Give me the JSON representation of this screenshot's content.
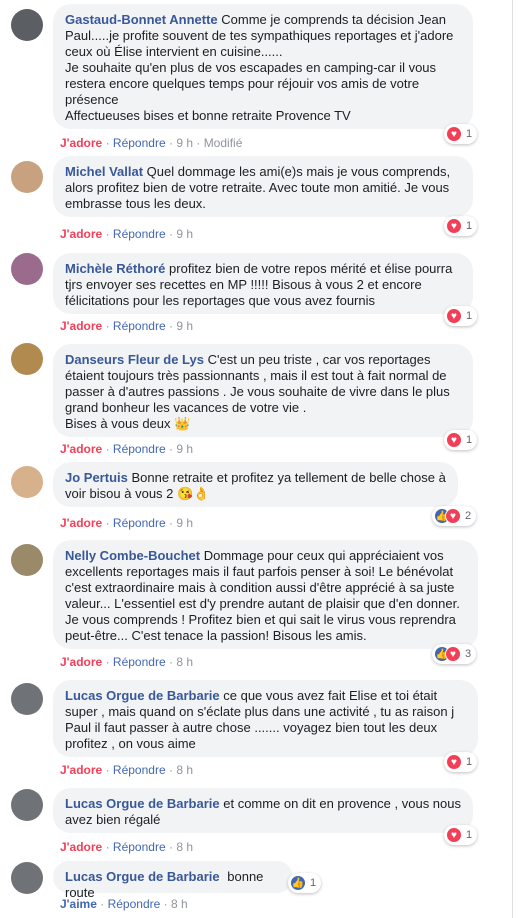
{
  "comments": [
    {
      "author": "Gastaud-Bonnet Annette",
      "text": "Comme je comprends ta décision Jean Paul.....je profite souvent de tes sympathiques reportages et j'adore ceux où Élise intervient en cuisine......\nJe souhaite qu'en plus de vos escapades en camping-car il vous restera encore quelques temps pour réjouir vos amis de votre présence\nAffectueuses bises et bonne retraite Provence TV",
      "like_label": "J'adore",
      "reply_label": "Répondre",
      "time": "9 h",
      "edited": "Modifié",
      "reaction_count": "1",
      "reactions": [
        "heart-icon"
      ]
    },
    {
      "author": "Michel Vallat",
      "text": "Quel dommage les ami(e)s mais je vous comprends, alors profitez bien de votre retraite. Avec toute mon amitié. Je vous embrasse tous les deux.",
      "like_label": "J'adore",
      "reply_label": "Répondre",
      "time": "9 h",
      "reaction_count": "1",
      "reactions": [
        "heart-icon"
      ]
    },
    {
      "author": "Michèle Réthoré",
      "text": "profitez bien de votre repos mérité et élise pourra tjrs envoyer ses recettes en MP !!!!! Bisous à vous 2 et encore félicitations pour les reportages que vous avez fournis",
      "like_label": "J'adore",
      "reply_label": "Répondre",
      "time": "9 h",
      "reaction_count": "1",
      "reactions": [
        "heart-icon"
      ]
    },
    {
      "author": "Danseurs Fleur de Lys",
      "text": "C'est un peu triste , car vos reportages étaient toujours très passionnants , mais il est tout à fait normal de passer à d'autres passions . Je vous souhaite de vivre dans le plus grand bonheur les vacances de votre vie .\nBises à vous deux 👑",
      "like_label": "J'adore",
      "reply_label": "Répondre",
      "time": "9 h",
      "reaction_count": "1",
      "reactions": [
        "heart-icon"
      ]
    },
    {
      "author": "Jo Pertuis",
      "text": "Bonne retraite et profitez ya tellement de belle chose à voir bisou à vous 2 😘👌",
      "like_label": "J'adore",
      "reply_label": "Répondre",
      "time": "9 h",
      "reaction_count": "2",
      "reactions": [
        "thumb-icon",
        "heart-icon"
      ]
    },
    {
      "author": "Nelly Combe-Bouchet",
      "text": "Dommage pour ceux qui appréciaient vos excellents reportages mais il faut parfois penser à soi! Le bénévolat c'est extraordinaire mais à condition aussi d'être apprécié à sa juste valeur... L'essentiel est d'y prendre autant de plaisir que d'en donner. Je vous comprends ! Profitez bien et qui sait le virus vous reprendra peut-être... C'est tenace la passion! Bisous les amis.",
      "like_label": "J'adore",
      "reply_label": "Répondre",
      "time": "8 h",
      "reaction_count": "3",
      "reactions": [
        "thumb-icon",
        "heart-icon"
      ]
    },
    {
      "author": "Lucas Orgue de Barbarie",
      "text": "ce que vous avez fait Elise et toi était super , mais quand on s'éclate plus dans une activité , tu as raison j Paul il faut passer à autre chose ....... voyagez bien tout les deux profitez , on vous aime",
      "like_label": "J'adore",
      "reply_label": "Répondre",
      "time": "8 h",
      "reaction_count": "1",
      "reactions": [
        "heart-icon"
      ]
    },
    {
      "author": "Lucas Orgue de Barbarie",
      "text": "et comme on dit en provence , vous nous avez bien régalé",
      "like_label": "J'adore",
      "reply_label": "Répondre",
      "time": "8 h",
      "reaction_count": "1",
      "reactions": [
        "heart-icon"
      ]
    },
    {
      "author": "Lucas Orgue de Barbarie",
      "text": "bonne route",
      "like_label": "J'aime",
      "reply_label": "Répondre",
      "time": "8 h",
      "reaction_count": "1",
      "reactions": [
        "thumb-icon"
      ]
    }
  ],
  "colors": {
    "author": "#385898",
    "adore": "#f33e58",
    "aime": "#4267b2",
    "bubble": "#f2f3f5",
    "meta": "#90949c"
  }
}
